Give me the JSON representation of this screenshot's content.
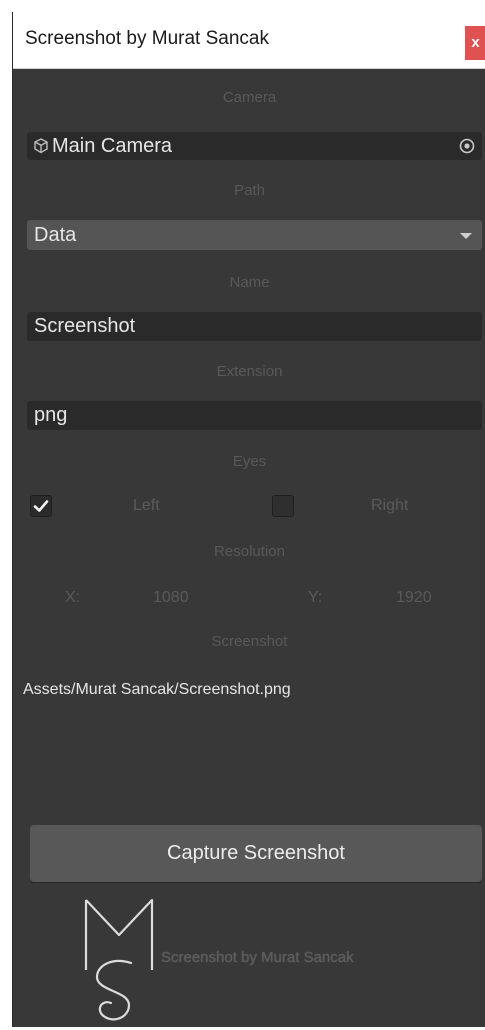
{
  "window": {
    "title": "Screenshot by Murat Sancak",
    "close_label": "x"
  },
  "camera": {
    "label": "Camera",
    "value": "Main Camera",
    "icon": "camera-cube-icon",
    "picker_icon": "object-picker-icon"
  },
  "path": {
    "label": "Path",
    "selected": "Data"
  },
  "name": {
    "label": "Name",
    "value": "Screenshot"
  },
  "extension": {
    "label": "Extension",
    "value": "png"
  },
  "eyes": {
    "label": "Eyes",
    "left_label": "Left",
    "left_checked": true,
    "right_label": "Right",
    "right_checked": false
  },
  "resolution": {
    "label": "Resolution",
    "x_label": "X:",
    "x_value": "1080",
    "y_label": "Y:",
    "y_value": "1920"
  },
  "screenshot": {
    "label": "Screenshot",
    "path": "Assets/Murat Sancak/Screenshot.png"
  },
  "capture_button_label": "Capture Screenshot",
  "footer": {
    "logo_icon": "ms-monogram-logo",
    "caption": "Screenshot by Murat Sancak"
  },
  "colors": {
    "panel_bg": "#383838",
    "field_bg": "#2a2a2a",
    "button_bg": "#585858",
    "close_bg": "#e05252"
  }
}
